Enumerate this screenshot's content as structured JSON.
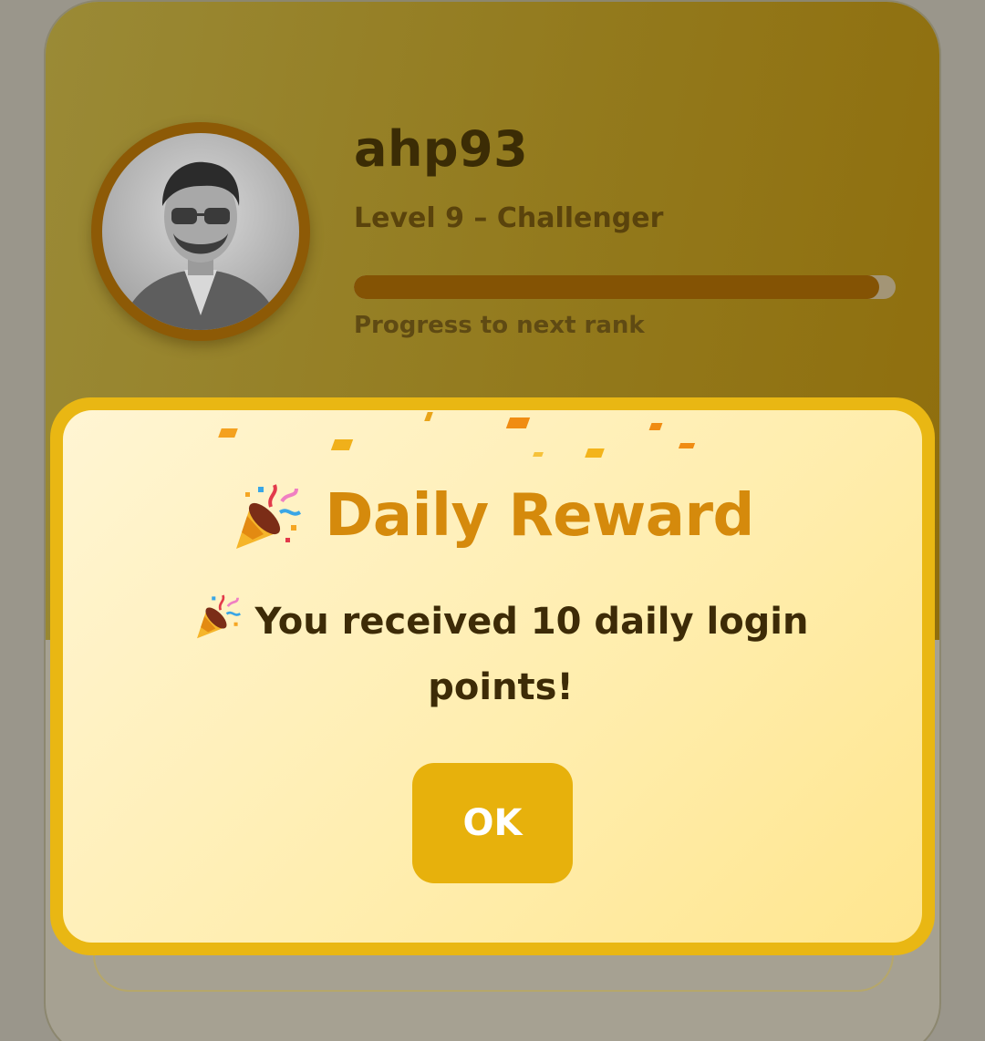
{
  "profile": {
    "username": "ahp93",
    "level_label": "Level 9 – Challenger",
    "progress_caption": "Progress to next rank",
    "progress_fraction": 0.97
  },
  "modal": {
    "title": "Daily Reward",
    "message": "You received 10 daily login points!",
    "ok_label": "OK",
    "title_emoji": "party-popper-icon",
    "message_emoji": "party-popper-icon"
  },
  "colors": {
    "accent": "#e9b713",
    "title": "#d58a0c",
    "progress_fill": "#845304"
  }
}
